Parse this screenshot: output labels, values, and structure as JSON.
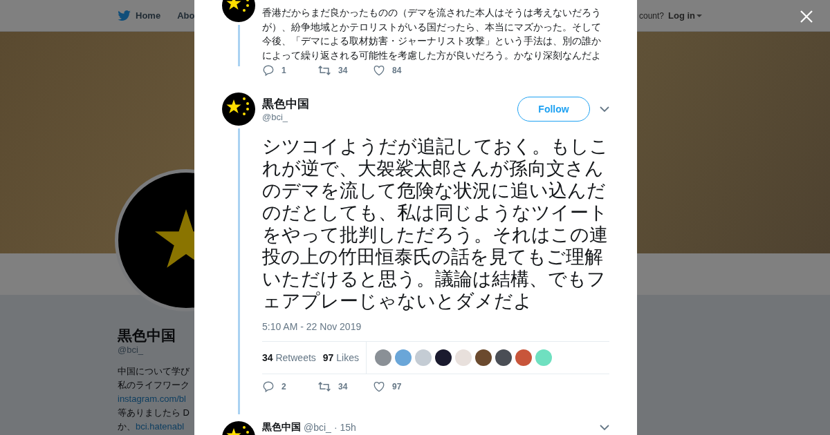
{
  "nav": {
    "items": [
      {
        "label": "Home",
        "icon": true
      },
      {
        "label": "Abo",
        "icon": false
      }
    ],
    "account_prompt": "count?",
    "login": "Log in"
  },
  "profile": {
    "name": "黒色中国",
    "handle": "@bci_",
    "bio_lines": [
      [
        {
          "kind": "text",
          "text": "中国について学び"
        }
      ],
      [
        {
          "kind": "text",
          "text": "私のライフワーク"
        }
      ],
      [
        {
          "kind": "link",
          "text": "instagram.com/bl"
        }
      ],
      [
        {
          "kind": "text",
          "text": "等ありましたら D"
        }
      ],
      [
        {
          "kind": "text",
          "text": "か、"
        },
        {
          "kind": "link",
          "text": "bci.hatenabl"
        }
      ]
    ]
  },
  "modal": {
    "previous_tweet": {
      "text": "香港だからまだ良かったものの（デマを流された本人はそうは考えないだろうが）、紛争地域とかテロリストがいる国だったら、本当にマズかった。そして今後、「デマによる取材妨害・ジャーナリスト攻撃」という手法は、別の誰かによって繰り返される可能性を考慮した方が良いだろう。かなり深刻なんだよ",
      "replies": "1",
      "retweets": "34",
      "likes": "84"
    },
    "main_tweet": {
      "name": "黒色中国",
      "handle": "@bci_",
      "follow": "Follow",
      "text": "シツコイようだが追記しておく。もしこれが逆で、大袈裟太郎さんが孫向文さんのデマを流して危険な状況に追い込んだのだとしても、私は同じようなツイートをやって批判しただろう。それはこの連投の上の竹田恒泰氏の話を見てもご理解いただけると思う。議論は結構、でもフェアプレーじゃないとダメだよ",
      "timestamp": "5:10 AM - 22 Nov 2019",
      "stats": [
        {
          "count": "34",
          "label": "Retweets"
        },
        {
          "count": "97",
          "label": "Likes"
        }
      ],
      "liked_by": [
        {
          "color": "#8a9096"
        },
        {
          "color": "#6aa6d8"
        },
        {
          "color": "#c4ccd4"
        },
        {
          "color": "#1a1a2e"
        },
        {
          "color": "#e8e0dc"
        },
        {
          "color": "#6b4a2e"
        },
        {
          "color": "#4a4e55"
        },
        {
          "color": "#c8553a"
        },
        {
          "color": "#6fe0c0"
        }
      ],
      "replies": "2",
      "retweets": "34",
      "likes": "97"
    },
    "next_tweet": {
      "name": "黒色中国",
      "handle": "@bci_",
      "time": "· 15h"
    }
  }
}
